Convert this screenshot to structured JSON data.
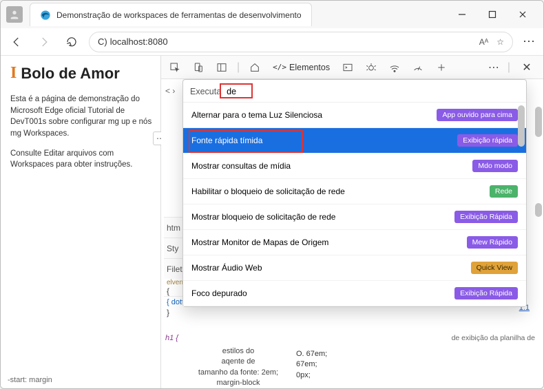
{
  "window": {
    "tab_title": "Demonstração de workspaces de ferramentas de desenvolvimento"
  },
  "urlbar": {
    "address_prefix": "C)",
    "address": "localhost:8080",
    "reader_badge": "Aᴬ"
  },
  "page": {
    "heading": "Bolo de Amor",
    "p1": "Esta é a página de demonstração do Microsoft Edge oficial Tutorial de DevT001s sobre configurar mg up e nós mg Workspaces.",
    "p2": "Consulte Editar arquivos com Workspaces para obter instruções.",
    "start_margin": "-start: margin"
  },
  "devtools": {
    "tab_elements": "Elementos",
    "source_stub": "< ›",
    "stub_html": "htm",
    "stub_styles": "Sty",
    "stub_files": "Filet",
    "elven": "elven hi",
    "brace1": "{",
    "brace2": "}",
    "dotted": "{ dotted",
    "link_num": "1:1",
    "styles_h1": "h1   {",
    "styles_note": "de exibição da planilha de",
    "styles_props": "estilos do\naqente de\ntamanho da fonte: 2em;\nmargin-block",
    "styles_vals": "O. 67em;\n67em;\n0px;"
  },
  "command_menu": {
    "prefix": "Executa",
    "input_value": "de",
    "items": [
      {
        "label": "Alternar para o tema Luz Silenciosa",
        "badge": "App ouvido para cima",
        "badge_cls": "b-purple"
      },
      {
        "label": "Fonte rápida tímida",
        "badge": "Exibição rápida",
        "badge_cls": "b-purple",
        "selected": true
      },
      {
        "label": "Mostrar consultas de mídia",
        "badge": "Mdo modo",
        "badge_cls": "b-purple"
      },
      {
        "label": "Habilitar o bloqueio de solicitação de rede",
        "badge": "Rede",
        "badge_cls": "b-green"
      },
      {
        "label": "Mostrar bloqueio de solicitação de rede",
        "badge": "Exibição Rápida",
        "badge_cls": "b-purple"
      },
      {
        "label": "Mostrar Monitor de Mapas de Origem",
        "badge": "Mew Rápido",
        "badge_cls": "b-purple"
      },
      {
        "label": "Mostrar Áudio Web",
        "badge": "Quick View",
        "badge_cls": "b-orange"
      },
      {
        "label": "Foco depurado",
        "badge": "Exibição Rápida",
        "badge_cls": "b-purple"
      }
    ]
  }
}
